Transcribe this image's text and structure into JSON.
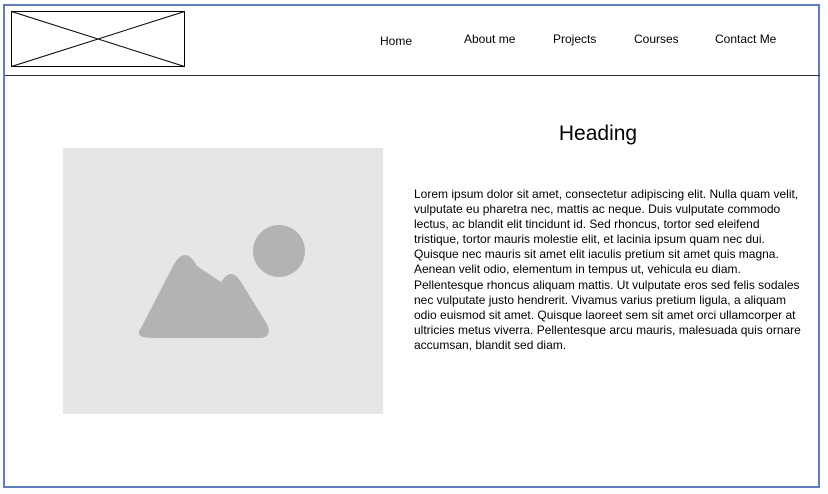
{
  "header": {
    "logo_icon": "logo-placeholder-icon",
    "nav": [
      {
        "label": "Home"
      },
      {
        "label": "About me"
      },
      {
        "label": "Projects"
      },
      {
        "label": "Courses"
      },
      {
        "label": "Contact Me"
      }
    ]
  },
  "main": {
    "image_icon": "image-placeholder-icon",
    "heading": "Heading",
    "body": "Lorem ipsum dolor sit amet, consectetur adipiscing elit. Nulla quam velit, vulputate eu pharetra nec, mattis ac neque. Duis vulputate commodo lectus, ac blandit elit tincidunt id. Sed rhoncus, tortor sed eleifend tristique, tortor mauris molestie elit, et lacinia ipsum quam nec dui. Quisque nec mauris sit amet elit iaculis pretium sit amet quis magna. Aenean velit odio, elementum in tempus ut, vehicula eu diam. Pellentesque rhoncus aliquam mattis. Ut vulputate eros sed felis sodales nec vulputate justo hendrerit. Vivamus varius pretium ligula, a aliquam odio euismod sit amet. Quisque laoreet sem sit amet orci ullamcorper at ultricies metus viverra. Pellentesque arcu mauris, malesuada quis ornare accumsan, blandit sed diam."
  },
  "colors": {
    "frame_border": "#5b7bd5",
    "image_bg": "#e6e6e6",
    "image_shape": "#b3b3b3"
  }
}
